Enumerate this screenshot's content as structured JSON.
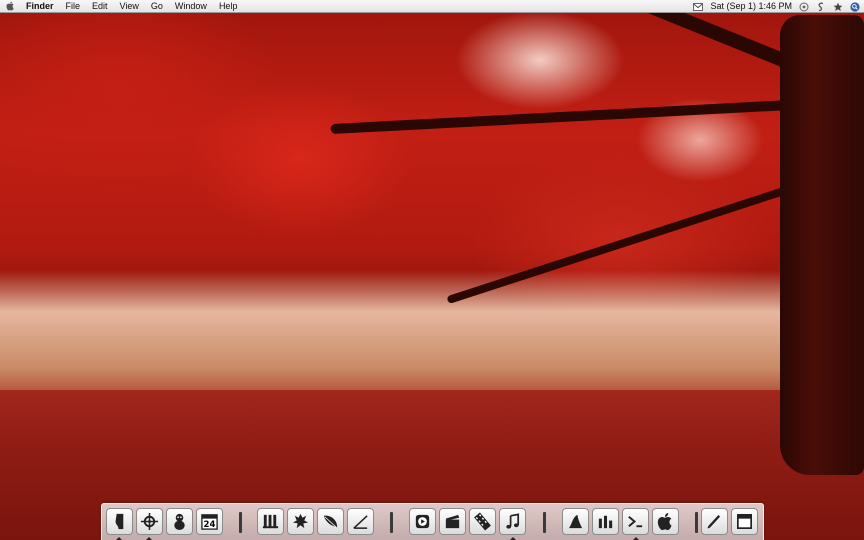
{
  "menubar": {
    "app_name": "Finder",
    "menus": [
      "File",
      "Edit",
      "View",
      "Go",
      "Window",
      "Help"
    ],
    "clock": "Sat  (Sep 1)  1:46 PM",
    "status_icons": [
      "gmail-icon",
      "sync-icon",
      "script-icon",
      "star-icon",
      "spotlight-icon"
    ]
  },
  "dock": {
    "groups": [
      [
        "finder-icon",
        "network-icon",
        "adium-icon",
        "ical-icon"
      ],
      [
        "dictionary-icon",
        "leaf-app-icon",
        "feather-icon",
        "editor-icon"
      ],
      [
        "quicktime-icon",
        "clapperboard-icon",
        "film-icon",
        "itunes-icon"
      ],
      [
        "sierra-icon",
        "bars-icon",
        "terminal-icon",
        "apple-icon"
      ],
      [
        "textedit-icon",
        "window-icon"
      ]
    ],
    "calendar_day": "24",
    "running": [
      "finder-icon",
      "network-icon",
      "itunes-icon",
      "terminal-icon"
    ]
  }
}
